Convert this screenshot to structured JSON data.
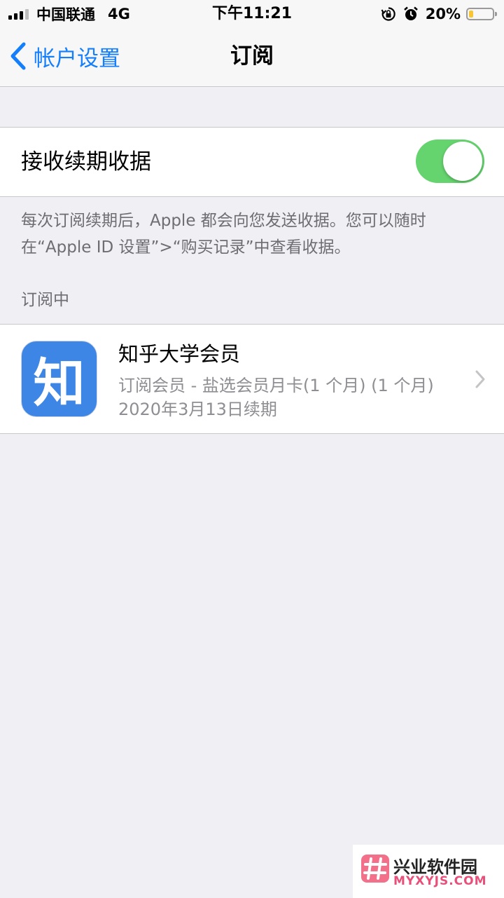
{
  "status_bar": {
    "carrier": "中国联通",
    "network": "4G",
    "time": "下午11:21",
    "battery_percent": "20%",
    "battery_level": 0.2,
    "icons": [
      "signal-icon",
      "rotation-lock-icon",
      "alarm-icon",
      "battery-icon"
    ]
  },
  "nav": {
    "back_label": "帐户设置",
    "title": "订阅"
  },
  "settings": {
    "renewal_receipts_label": "接收续期收据",
    "renewal_receipts_on": true,
    "footer": "每次订阅续期后，Apple 都会向您发送收据。您可以随时在“Apple ID 设置”>“购买记录”中查看收据。"
  },
  "subscriptions": {
    "header": "订阅中",
    "items": [
      {
        "icon_text": "知",
        "title": "知乎大学会员",
        "detail": "订阅会员 - 盐选会员月卡(1 个月) (1 个月)",
        "renewal": "2020年3月13日续期"
      }
    ]
  },
  "watermark": {
    "title": "兴业软件园",
    "subtitle": "MYXYJS.COM"
  },
  "colors": {
    "accent": "#147EFB",
    "toggle_on": "#65D36E",
    "background": "#EFEFF4",
    "app_icon": "#3D86E6"
  }
}
